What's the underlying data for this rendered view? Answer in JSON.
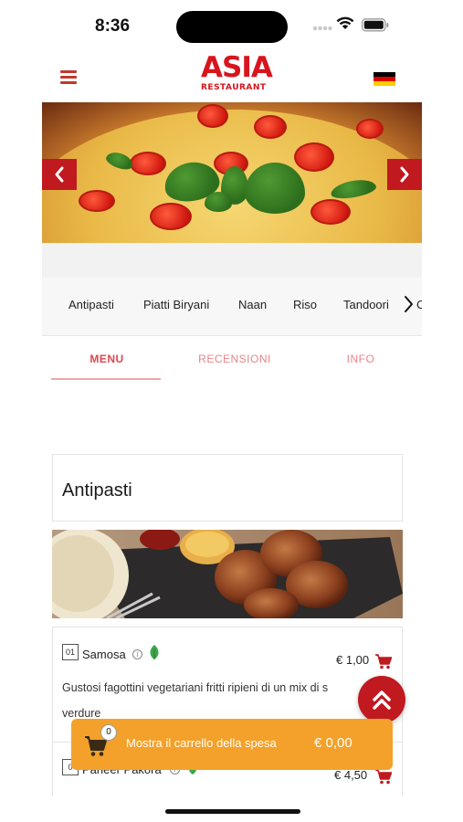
{
  "status_bar": {
    "time": "8:36"
  },
  "header": {
    "logo_main": "ASIA",
    "logo_sub": "RESTAURANT",
    "menu_icon": "hamburger-icon",
    "language_flag": "german-flag-icon",
    "brand_color": "#d8141d"
  },
  "hero": {
    "prev_icon": "chevron-left-icon",
    "next_icon": "chevron-right-icon"
  },
  "categories": {
    "items": [
      "Antipasti",
      "Piatti Biryani",
      "Naan",
      "Riso",
      "Tandoori"
    ],
    "peek": "C",
    "more_icon": "chevron-right-icon"
  },
  "tabs": {
    "menu": "MENU",
    "reviews": "RECENSIONI",
    "info": "INFO",
    "active": "MENU"
  },
  "section": {
    "title": "Antipasti"
  },
  "items": [
    {
      "number": "01",
      "name": "Samosa",
      "price": "€ 1,00",
      "description": "Gustosi fagottini vegetariani fritti ripieni di un mix di s",
      "description_line2": "verdure",
      "vegetarian": true
    },
    {
      "number": "0",
      "name": "Paneer Pakora",
      "price": "€ 4,50",
      "vegetarian": true
    }
  ],
  "cart": {
    "count": "0",
    "label": "Mostra il carrello della spesa",
    "total": "€ 0,00",
    "color": "#f3a12b"
  },
  "accent_color": "#c0191f"
}
